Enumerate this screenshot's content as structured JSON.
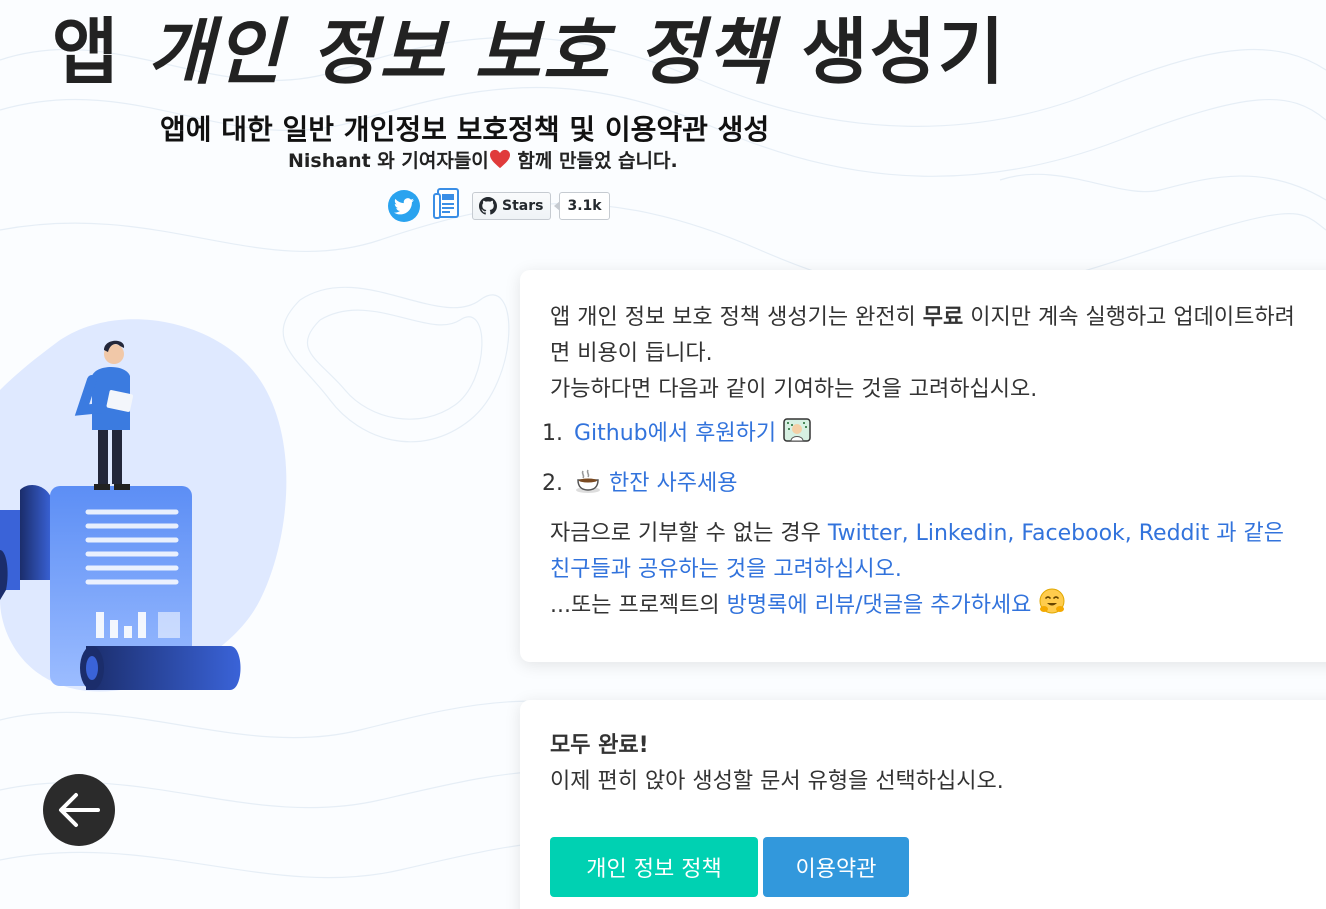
{
  "header": {
    "title_prefix": "앱 ",
    "title_italic": "개인 정보 보호 정책",
    "title_suffix": " 생성기",
    "subtitle": "앱에 대한 일반 개인정보 보호정책 및 이용약관 생성",
    "credit_before": "Nishant 와 기여자들이",
    "credit_after": " 함께 만들었 습니다.",
    "github_stars_label": "Stars",
    "github_stars_count": "3.1k"
  },
  "donate_card": {
    "intro_1": "앱 개인 정보 보호 정책 생성기는 완전히 ",
    "intro_bold": "무료",
    "intro_2": " 이지만 계속 실행하고 업데이트하려면 비용이 듭니다.",
    "intro_3": "가능하다면 다음과 같이 기여하는 것을 고려하십시오.",
    "items": [
      {
        "link": "Github에서 후원하기"
      },
      {
        "link": "한잔 사주세용"
      }
    ],
    "share_before": "자금으로 기부할 수 없는 경우 ",
    "share_link": "Twitter, Linkedin, Facebook, Reddit 과 같은 친구들과 공유하는 것을 고려하십시오.",
    "guestbook_before": "...또는 프로젝트의 ",
    "guestbook_link": "방명록에 리뷰/댓글을 추가하세요"
  },
  "done_card": {
    "heading": "모두 완료!",
    "instruction": "이제 편히 앉아 생성할 문서 유형을 선택하십시오.",
    "buttons": {
      "privacy": "개인 정보 정책",
      "terms": "이용약관"
    }
  },
  "colors": {
    "primary": "#00d1b2",
    "info": "#3298dc",
    "link": "#3273dc",
    "twitter": "#2aa3ef"
  }
}
